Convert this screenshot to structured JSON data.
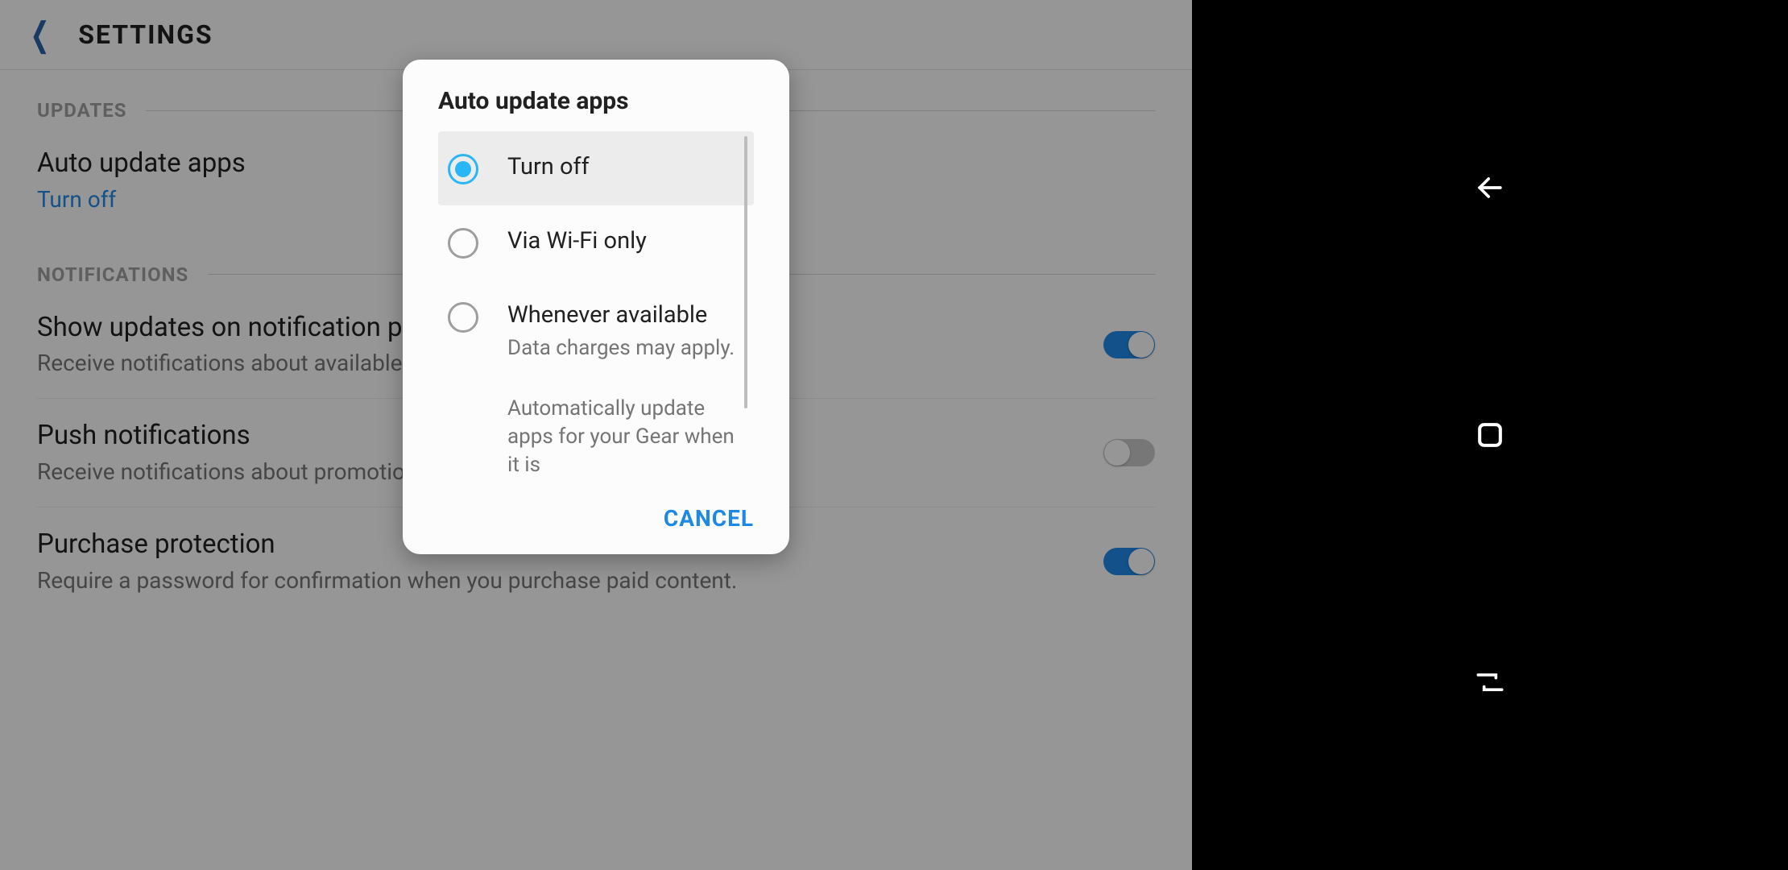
{
  "header": {
    "title": "SETTINGS"
  },
  "sections": {
    "updates": {
      "label": "UPDATES",
      "auto_update": {
        "title": "Auto update apps",
        "value": "Turn off"
      }
    },
    "notifications": {
      "label": "NOTIFICATIONS",
      "show_updates": {
        "title": "Show updates on notification panel",
        "subtitle": "Receive notifications about available app updates."
      },
      "push": {
        "title": "Push notifications",
        "subtitle": "Receive notifications about promotions and"
      },
      "purchase_protection": {
        "title": "Purchase protection",
        "subtitle": "Require a password for confirmation when you purchase paid content."
      }
    }
  },
  "dialog": {
    "title": "Auto update apps",
    "options": [
      {
        "label": "Turn off",
        "desc": "",
        "selected": true
      },
      {
        "label": "Via Wi-Fi only",
        "desc": "",
        "selected": false
      },
      {
        "label": "Whenever available",
        "desc": "Data charges may apply.",
        "selected": false
      }
    ],
    "extra": "Automatically update apps for your Gear when it is",
    "cancel": "CANCEL"
  }
}
